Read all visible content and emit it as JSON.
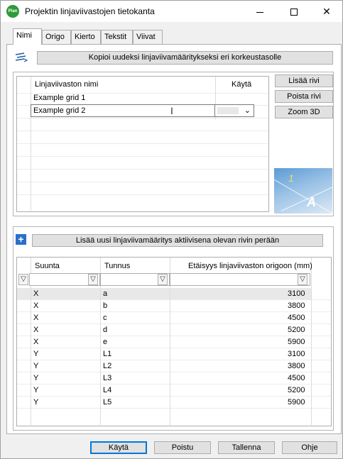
{
  "window": {
    "icon_text": "Plan",
    "title": "Projektin linjaviivastojen tietokanta",
    "min_glyph": "",
    "close_glyph": "✕"
  },
  "tabs": [
    {
      "label": "Nimi",
      "active": true
    },
    {
      "label": "Origo",
      "active": false
    },
    {
      "label": "Kierto",
      "active": false
    },
    {
      "label": "Tekstit",
      "active": false
    },
    {
      "label": "Viivat",
      "active": false
    }
  ],
  "top": {
    "copy_button": "Kopioi uudeksi linjaviivamääritykseksi eri korkeustasolle",
    "col_name": "Linjaviivaston nimi",
    "col_use": "Käytä",
    "rows": [
      {
        "name": "Example grid 1",
        "use": ""
      },
      {
        "name": "Example grid 2",
        "use": ""
      }
    ],
    "combo_arrow": "⌄",
    "add_row": "Lisää rivi",
    "remove_row": "Poista rivi",
    "zoom": "Zoom 3D",
    "preview_labels": {
      "top": "1",
      "bottom": "A"
    }
  },
  "bottom": {
    "add_button": "Lisää uusi linjaviivamääritys aktiivisena olevan rivin perään",
    "plus_glyph": "+",
    "col_direction": "Suunta",
    "col_id": "Tunnus",
    "col_distance": "Etäisyys linjaviivaston origoon (mm)",
    "filter_glyph": "▽",
    "rows": [
      {
        "dir": "X",
        "id": "a",
        "dist": "3100"
      },
      {
        "dir": "X",
        "id": "b",
        "dist": "3800"
      },
      {
        "dir": "X",
        "id": "c",
        "dist": "4500"
      },
      {
        "dir": "X",
        "id": "d",
        "dist": "5200"
      },
      {
        "dir": "X",
        "id": "e",
        "dist": "5900"
      },
      {
        "dir": "Y",
        "id": "L1",
        "dist": "3100"
      },
      {
        "dir": "Y",
        "id": "L2",
        "dist": "3800"
      },
      {
        "dir": "Y",
        "id": "L3",
        "dist": "4500"
      },
      {
        "dir": "Y",
        "id": "L4",
        "dist": "5200"
      },
      {
        "dir": "Y",
        "id": "L5",
        "dist": "5900"
      }
    ]
  },
  "footer": {
    "apply": "Käytä",
    "exit": "Poistu",
    "save": "Tallenna",
    "help": "Ohje"
  },
  "colors": {
    "accent": "#0078d7",
    "app_icon": "#2e9b3a",
    "plus_icon": "#2a6fc9"
  }
}
